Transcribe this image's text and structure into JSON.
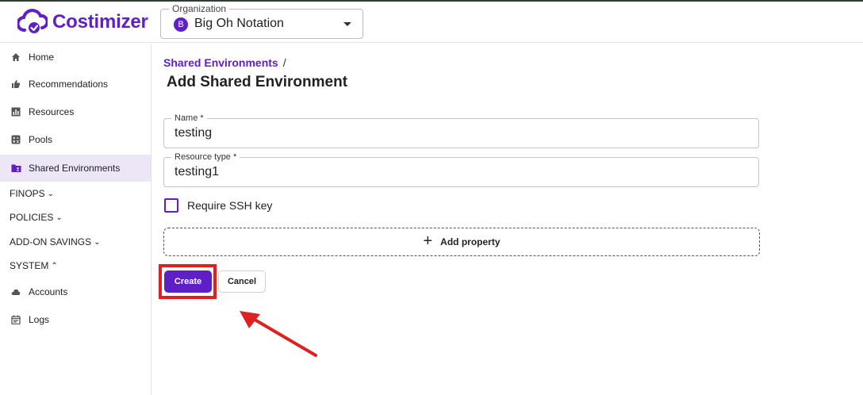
{
  "app": {
    "brand_name": "Costimizer",
    "brand_color": "#5f1fc7"
  },
  "organization": {
    "label": "Organization",
    "avatar_letter": "B",
    "value": "Big Oh Notation"
  },
  "sidebar": {
    "items": [
      {
        "label": "Home",
        "icon": "home-icon"
      },
      {
        "label": "Recommendations",
        "icon": "thumbs-up-icon"
      },
      {
        "label": "Resources",
        "icon": "bar-chart-icon"
      },
      {
        "label": "Pools",
        "icon": "calculator-icon"
      },
      {
        "label": "Shared Environments",
        "icon": "folder-icon",
        "active": true
      }
    ],
    "sections": [
      "FINOPS",
      "POLICIES",
      "ADD-ON SAVINGS",
      "SYSTEM"
    ],
    "system_items": [
      {
        "label": "Accounts",
        "icon": "cloud-icon"
      },
      {
        "label": "Logs",
        "icon": "calendar-icon"
      }
    ]
  },
  "main": {
    "breadcrumb": "Shared Environments",
    "breadcrumb_sep": "/",
    "title": "Add Shared Environment",
    "form": {
      "name_label": "Name *",
      "name_value": "testing",
      "resource_type_label": "Resource type *",
      "resource_type_value": "testing1",
      "ssh_label": "Require SSH key",
      "ssh_checked": false,
      "add_property_label": "Add property",
      "create_label": "Create",
      "cancel_label": "Cancel"
    }
  },
  "annotation": {
    "highlight_color": "#e02020",
    "highlight_target": "Create"
  }
}
